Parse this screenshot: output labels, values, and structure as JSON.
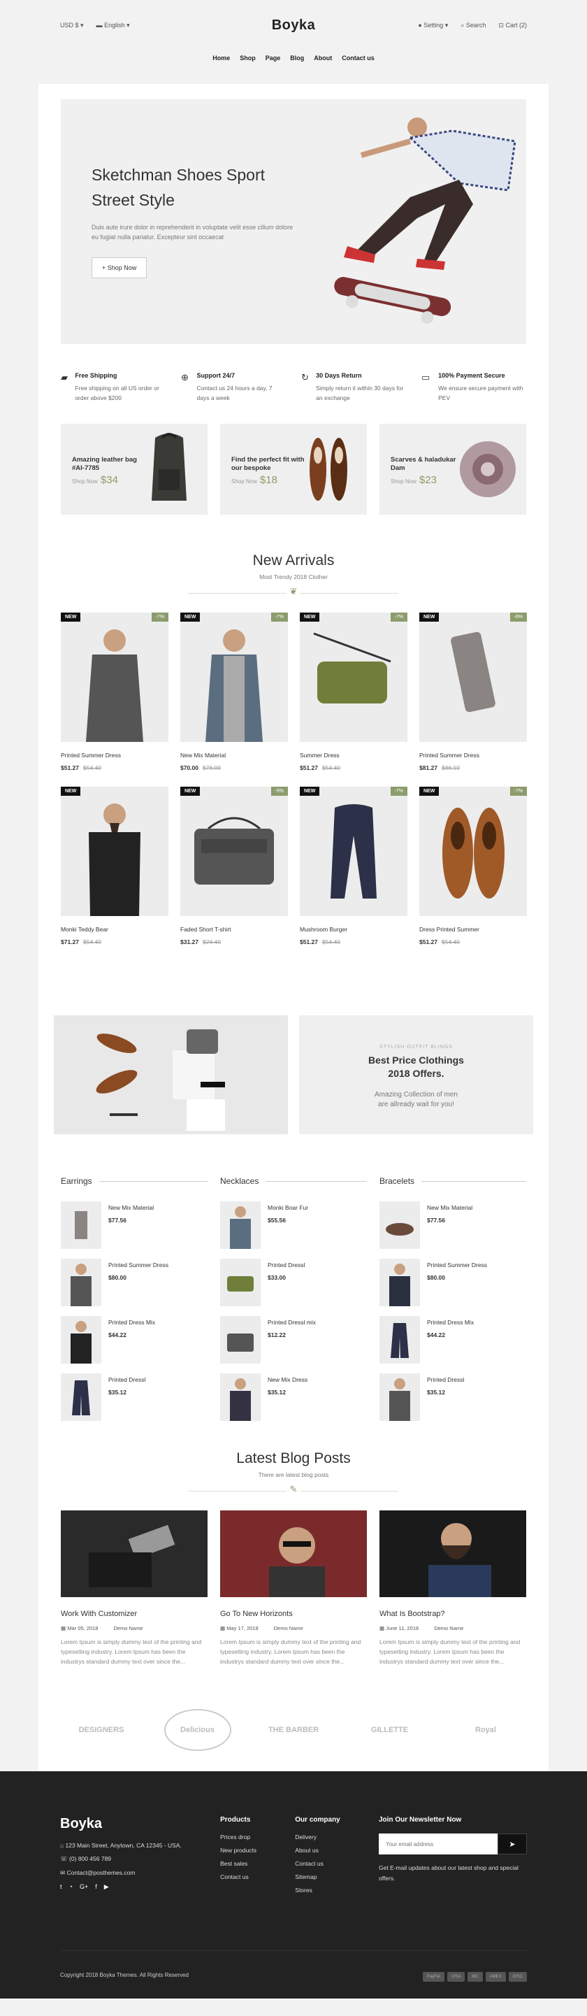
{
  "topbar": {
    "currency": "USD $",
    "language": "English",
    "logo": "Boyka",
    "setting": "Setting",
    "search": "Search",
    "cart": "Cart (2)"
  },
  "nav": [
    "Home",
    "Shop",
    "Page",
    "Blog",
    "About",
    "Contact us"
  ],
  "hero": {
    "title": "Sketchman Shoes Sport Street Style",
    "desc": "Duis aute irure dolor in reprehenderit in voluptate velit esse cillum dolore eu fugiat nulla pariatur. Excepteur sint occaecat",
    "button": "Shop Now"
  },
  "features": [
    {
      "icon": "truck-icon",
      "title": "Free Shipping",
      "desc": "Free shipping on all US order or order above $200"
    },
    {
      "icon": "support-icon",
      "title": "Support 24/7",
      "desc": "Contact us 24 hours a day, 7 days a week"
    },
    {
      "icon": "return-icon",
      "title": "30 Days Return",
      "desc": "Simply return it within 30 days for an exchange"
    },
    {
      "icon": "card-icon",
      "title": "100% Payment Secure",
      "desc": "We ensure secure payment with PEV"
    }
  ],
  "banners": [
    {
      "title": "Amazing leather bag #AI-7785",
      "shop": "Shop Now",
      "price": "$34"
    },
    {
      "title": "Find the perfect fit with our bespoke",
      "shop": "Shop Now",
      "price": "$18"
    },
    {
      "title": "Scarves & haladukar Dam",
      "shop": "Shop Now",
      "price": "$23"
    }
  ],
  "new_arrivals": {
    "title": "New Arrivals",
    "subtitle": "Most Trendy 2018 Clother",
    "products": [
      {
        "name": "Printed Summer Dress",
        "price": "$51.27",
        "old": "$54.40",
        "badge": "NEW",
        "off": "-7%"
      },
      {
        "name": "New Mix Material",
        "price": "$70.00",
        "old": "$76.00",
        "badge": "NEW",
        "off": "-7%"
      },
      {
        "name": "Summer Dress",
        "price": "$51.27",
        "old": "$54.40",
        "badge": "NEW",
        "off": "-7%"
      },
      {
        "name": "Printed Summer Dress",
        "price": "$81.27",
        "old": "$86.10",
        "badge": "NEW",
        "off": "-6%"
      },
      {
        "name": "Monki Teddy Bear",
        "price": "$71.27",
        "old": "$54.40",
        "badge": "NEW",
        "off": ""
      },
      {
        "name": "Faded Short T-shirt",
        "price": "$31.27",
        "old": "$24.40",
        "badge": "NEW",
        "off": "-9%"
      },
      {
        "name": "Mushroom Burger",
        "price": "$51.27",
        "old": "$54.40",
        "badge": "NEW",
        "off": "-7%"
      },
      {
        "name": "Dress Printed Summer",
        "price": "$51.27",
        "old": "$54.40",
        "badge": "NEW",
        "off": "-7%"
      }
    ]
  },
  "promo": {
    "kicker": "STYLISH OUTFIT BLINGS",
    "title_1": "Best Price Clothings",
    "title_2": "2018 Offers.",
    "desc_1": "Amazing Collection of men",
    "desc_2": "are allready wait for you!"
  },
  "columns": [
    {
      "title": "Earrings",
      "items": [
        {
          "name": "New Mix Material",
          "price": "$77.56"
        },
        {
          "name": "Printed Summer Dress",
          "price": "$80.00"
        },
        {
          "name": "Printed Dress Mix",
          "price": "$44.22"
        },
        {
          "name": "Printed Dressl",
          "price": "$35.12"
        }
      ]
    },
    {
      "title": "Necklaces",
      "items": [
        {
          "name": "Monki Boar Fur",
          "price": "$55.56"
        },
        {
          "name": "Printed Dressl",
          "price": "$33.00"
        },
        {
          "name": "Printed Dressl mix",
          "price": "$12.22"
        },
        {
          "name": "New Mix Dress",
          "price": "$35.12"
        }
      ]
    },
    {
      "title": "Bracelets",
      "items": [
        {
          "name": "New Mix Material",
          "price": "$77.56"
        },
        {
          "name": "Printed Summer Dress",
          "price": "$80.00"
        },
        {
          "name": "Printed Dress Mix",
          "price": "$44.22"
        },
        {
          "name": "Printed Dressl",
          "price": "$35.12"
        }
      ]
    }
  ],
  "blog": {
    "title": "Latest Blog Posts",
    "subtitle": "There are latest blog posts",
    "posts": [
      {
        "title": "Work With Customizer",
        "date": "Mar 05, 2018",
        "author": "Demo Name",
        "desc": "Lorem Ipsum is simply dummy text of the printing and typesetting industry. Lorem Ipsum has been the industrys standard dummy text over since the..."
      },
      {
        "title": "Go To New Horizonts",
        "date": "May 17, 2018",
        "author": "Demo Name",
        "desc": "Lorem Ipsum is simply dummy text of the printing and typesetting industry. Lorem Ipsum has been the industrys standard dummy text over since the..."
      },
      {
        "title": "What Is Bootstrap?",
        "date": "June 11, 2018",
        "author": "Demo Name",
        "desc": "Lorem Ipsum is simply dummy text of the printing and typesetting industry. Lorem Ipsum has been the industrys standard dummy text over since the..."
      }
    ]
  },
  "brands": [
    "DESIGNERS",
    "Delicious",
    "THE BARBER",
    "GILLETTE",
    "Royal"
  ],
  "footer": {
    "logo": "Boyka",
    "address": "123 Main Street, Anytown, CA 12345 - USA.",
    "phone": "(0) 800 456 789",
    "email": "Contact@posthemes.com",
    "products_title": "Products",
    "products": [
      "Prices drop",
      "New products",
      "Best sales",
      "Contact us"
    ],
    "company_title": "Our company",
    "company": [
      "Delivery",
      "About us",
      "Contact us",
      "Sitemap",
      "Stores"
    ],
    "newsletter_title": "Join Our Newsletter Now",
    "newsletter_placeholder": "Your email address",
    "newsletter_text": "Get E-mail updates about our latest shop and special offers.",
    "copyright": "Copyright 2018 Boyka Themes. All Rights Reserved",
    "payments": [
      "PayPal",
      "VISA",
      "MC",
      "AMEX",
      "DISC"
    ]
  },
  "colors": {
    "accent": "#8c9c6c",
    "dark": "#222222"
  }
}
